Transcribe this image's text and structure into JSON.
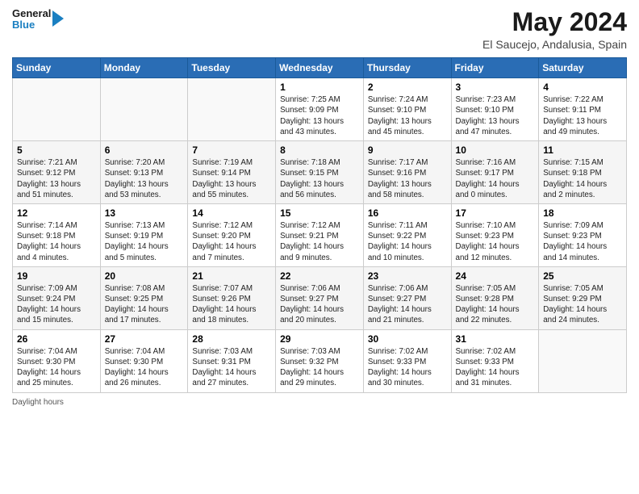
{
  "header": {
    "logo_general": "General",
    "logo_blue": "Blue",
    "title": "May 2024",
    "subtitle": "El Saucejo, Andalusia, Spain"
  },
  "days_of_week": [
    "Sunday",
    "Monday",
    "Tuesday",
    "Wednesday",
    "Thursday",
    "Friday",
    "Saturday"
  ],
  "weeks": [
    [
      {
        "day": "",
        "info": ""
      },
      {
        "day": "",
        "info": ""
      },
      {
        "day": "",
        "info": ""
      },
      {
        "day": "1",
        "info": "Sunrise: 7:25 AM\nSunset: 9:09 PM\nDaylight: 13 hours\nand 43 minutes."
      },
      {
        "day": "2",
        "info": "Sunrise: 7:24 AM\nSunset: 9:10 PM\nDaylight: 13 hours\nand 45 minutes."
      },
      {
        "day": "3",
        "info": "Sunrise: 7:23 AM\nSunset: 9:10 PM\nDaylight: 13 hours\nand 47 minutes."
      },
      {
        "day": "4",
        "info": "Sunrise: 7:22 AM\nSunset: 9:11 PM\nDaylight: 13 hours\nand 49 minutes."
      }
    ],
    [
      {
        "day": "5",
        "info": "Sunrise: 7:21 AM\nSunset: 9:12 PM\nDaylight: 13 hours\nand 51 minutes."
      },
      {
        "day": "6",
        "info": "Sunrise: 7:20 AM\nSunset: 9:13 PM\nDaylight: 13 hours\nand 53 minutes."
      },
      {
        "day": "7",
        "info": "Sunrise: 7:19 AM\nSunset: 9:14 PM\nDaylight: 13 hours\nand 55 minutes."
      },
      {
        "day": "8",
        "info": "Sunrise: 7:18 AM\nSunset: 9:15 PM\nDaylight: 13 hours\nand 56 minutes."
      },
      {
        "day": "9",
        "info": "Sunrise: 7:17 AM\nSunset: 9:16 PM\nDaylight: 13 hours\nand 58 minutes."
      },
      {
        "day": "10",
        "info": "Sunrise: 7:16 AM\nSunset: 9:17 PM\nDaylight: 14 hours\nand 0 minutes."
      },
      {
        "day": "11",
        "info": "Sunrise: 7:15 AM\nSunset: 9:18 PM\nDaylight: 14 hours\nand 2 minutes."
      }
    ],
    [
      {
        "day": "12",
        "info": "Sunrise: 7:14 AM\nSunset: 9:18 PM\nDaylight: 14 hours\nand 4 minutes."
      },
      {
        "day": "13",
        "info": "Sunrise: 7:13 AM\nSunset: 9:19 PM\nDaylight: 14 hours\nand 5 minutes."
      },
      {
        "day": "14",
        "info": "Sunrise: 7:12 AM\nSunset: 9:20 PM\nDaylight: 14 hours\nand 7 minutes."
      },
      {
        "day": "15",
        "info": "Sunrise: 7:12 AM\nSunset: 9:21 PM\nDaylight: 14 hours\nand 9 minutes."
      },
      {
        "day": "16",
        "info": "Sunrise: 7:11 AM\nSunset: 9:22 PM\nDaylight: 14 hours\nand 10 minutes."
      },
      {
        "day": "17",
        "info": "Sunrise: 7:10 AM\nSunset: 9:23 PM\nDaylight: 14 hours\nand 12 minutes."
      },
      {
        "day": "18",
        "info": "Sunrise: 7:09 AM\nSunset: 9:23 PM\nDaylight: 14 hours\nand 14 minutes."
      }
    ],
    [
      {
        "day": "19",
        "info": "Sunrise: 7:09 AM\nSunset: 9:24 PM\nDaylight: 14 hours\nand 15 minutes."
      },
      {
        "day": "20",
        "info": "Sunrise: 7:08 AM\nSunset: 9:25 PM\nDaylight: 14 hours\nand 17 minutes."
      },
      {
        "day": "21",
        "info": "Sunrise: 7:07 AM\nSunset: 9:26 PM\nDaylight: 14 hours\nand 18 minutes."
      },
      {
        "day": "22",
        "info": "Sunrise: 7:06 AM\nSunset: 9:27 PM\nDaylight: 14 hours\nand 20 minutes."
      },
      {
        "day": "23",
        "info": "Sunrise: 7:06 AM\nSunset: 9:27 PM\nDaylight: 14 hours\nand 21 minutes."
      },
      {
        "day": "24",
        "info": "Sunrise: 7:05 AM\nSunset: 9:28 PM\nDaylight: 14 hours\nand 22 minutes."
      },
      {
        "day": "25",
        "info": "Sunrise: 7:05 AM\nSunset: 9:29 PM\nDaylight: 14 hours\nand 24 minutes."
      }
    ],
    [
      {
        "day": "26",
        "info": "Sunrise: 7:04 AM\nSunset: 9:30 PM\nDaylight: 14 hours\nand 25 minutes."
      },
      {
        "day": "27",
        "info": "Sunrise: 7:04 AM\nSunset: 9:30 PM\nDaylight: 14 hours\nand 26 minutes."
      },
      {
        "day": "28",
        "info": "Sunrise: 7:03 AM\nSunset: 9:31 PM\nDaylight: 14 hours\nand 27 minutes."
      },
      {
        "day": "29",
        "info": "Sunrise: 7:03 AM\nSunset: 9:32 PM\nDaylight: 14 hours\nand 29 minutes."
      },
      {
        "day": "30",
        "info": "Sunrise: 7:02 AM\nSunset: 9:33 PM\nDaylight: 14 hours\nand 30 minutes."
      },
      {
        "day": "31",
        "info": "Sunrise: 7:02 AM\nSunset: 9:33 PM\nDaylight: 14 hours\nand 31 minutes."
      },
      {
        "day": "",
        "info": ""
      }
    ]
  ],
  "footer": {
    "daylight_label": "Daylight hours"
  }
}
